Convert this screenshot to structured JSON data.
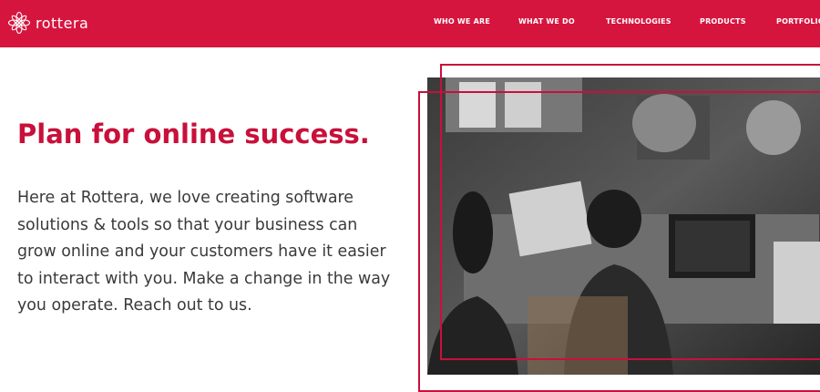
{
  "brand": {
    "name": "rottera",
    "logo_icon": "flower-mandala-icon"
  },
  "nav": {
    "items": [
      {
        "label": "WHO WE ARE"
      },
      {
        "label": "WHAT WE DO"
      },
      {
        "label": "TECHNOLOGIES"
      },
      {
        "label": "PRODUCTS"
      },
      {
        "label": "PORTFOLIO"
      }
    ]
  },
  "hero": {
    "title": "Plan for online success.",
    "description": "Here at Rottera, we love creating software solutions & tools so that your business can grow online and your customers have it easier to interact with you. Make a change in the way you operate. Reach out to us."
  },
  "colors": {
    "brand": "#d6153e",
    "accent": "#c8103a",
    "text": "#3a3a3a"
  }
}
